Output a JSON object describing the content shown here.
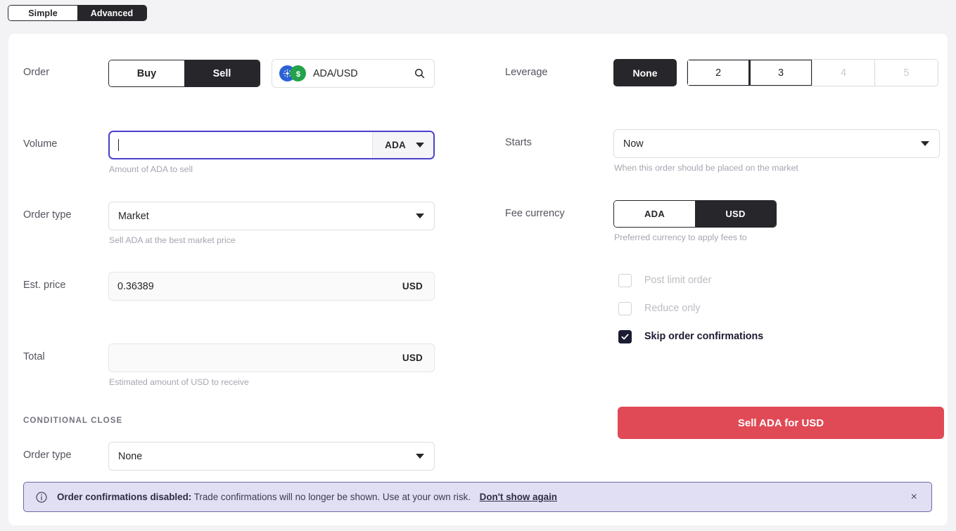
{
  "mode_toggle": {
    "options": [
      {
        "label": "Simple",
        "active": false
      },
      {
        "label": "Advanced",
        "active": true
      }
    ]
  },
  "order": {
    "label": "Order",
    "side_buy": "Buy",
    "side_sell": "Sell",
    "active_side": "Sell",
    "pair": "ADA/USD",
    "base_asset": "ADA",
    "quote_asset": "USD",
    "search_icon": "search-icon"
  },
  "leverage": {
    "label": "Leverage",
    "none_label": "None",
    "options": [
      "2",
      "3",
      "4",
      "5"
    ],
    "enabled": [
      "2",
      "3"
    ],
    "disabled": [
      "4",
      "5"
    ],
    "selected": "None"
  },
  "volume": {
    "label": "Volume",
    "value": "",
    "unit": "ADA",
    "hint": "Amount of ADA to sell",
    "focused": true
  },
  "starts": {
    "label": "Starts",
    "value": "Now",
    "hint": "When this order should be placed on the market"
  },
  "order_type": {
    "label": "Order type",
    "value": "Market",
    "hint": "Sell ADA at the best market price"
  },
  "fee_currency": {
    "label": "Fee currency",
    "options": [
      {
        "label": "ADA",
        "active": false
      },
      {
        "label": "USD",
        "active": true
      }
    ],
    "hint": "Preferred currency to apply fees to"
  },
  "est_price": {
    "label": "Est. price",
    "value": "0.36389",
    "unit": "USD"
  },
  "total": {
    "label": "Total",
    "value": "",
    "unit": "USD",
    "hint": "Estimated amount of USD to receive"
  },
  "options": {
    "post_limit_order": {
      "label": "Post limit order",
      "checked": false,
      "disabled": true
    },
    "reduce_only": {
      "label": "Reduce only",
      "checked": false,
      "disabled": true
    },
    "skip_order_confirmations": {
      "label": "Skip order confirmations",
      "checked": true,
      "disabled": false
    }
  },
  "conditional_close": {
    "heading": "CONDITIONAL CLOSE",
    "order_type_label": "Order type",
    "order_type_value": "None"
  },
  "submit": {
    "label": "Sell ADA for USD",
    "color": "#e04a56"
  },
  "banner": {
    "title": "Order confirmations disabled:",
    "message": "Trade confirmations will no longer be shown. Use at your own risk.",
    "link": "Don't show again",
    "close_label": "×",
    "info_icon": "info-circle-icon",
    "background": "#e1dff4",
    "border": "#6d6aa0"
  }
}
